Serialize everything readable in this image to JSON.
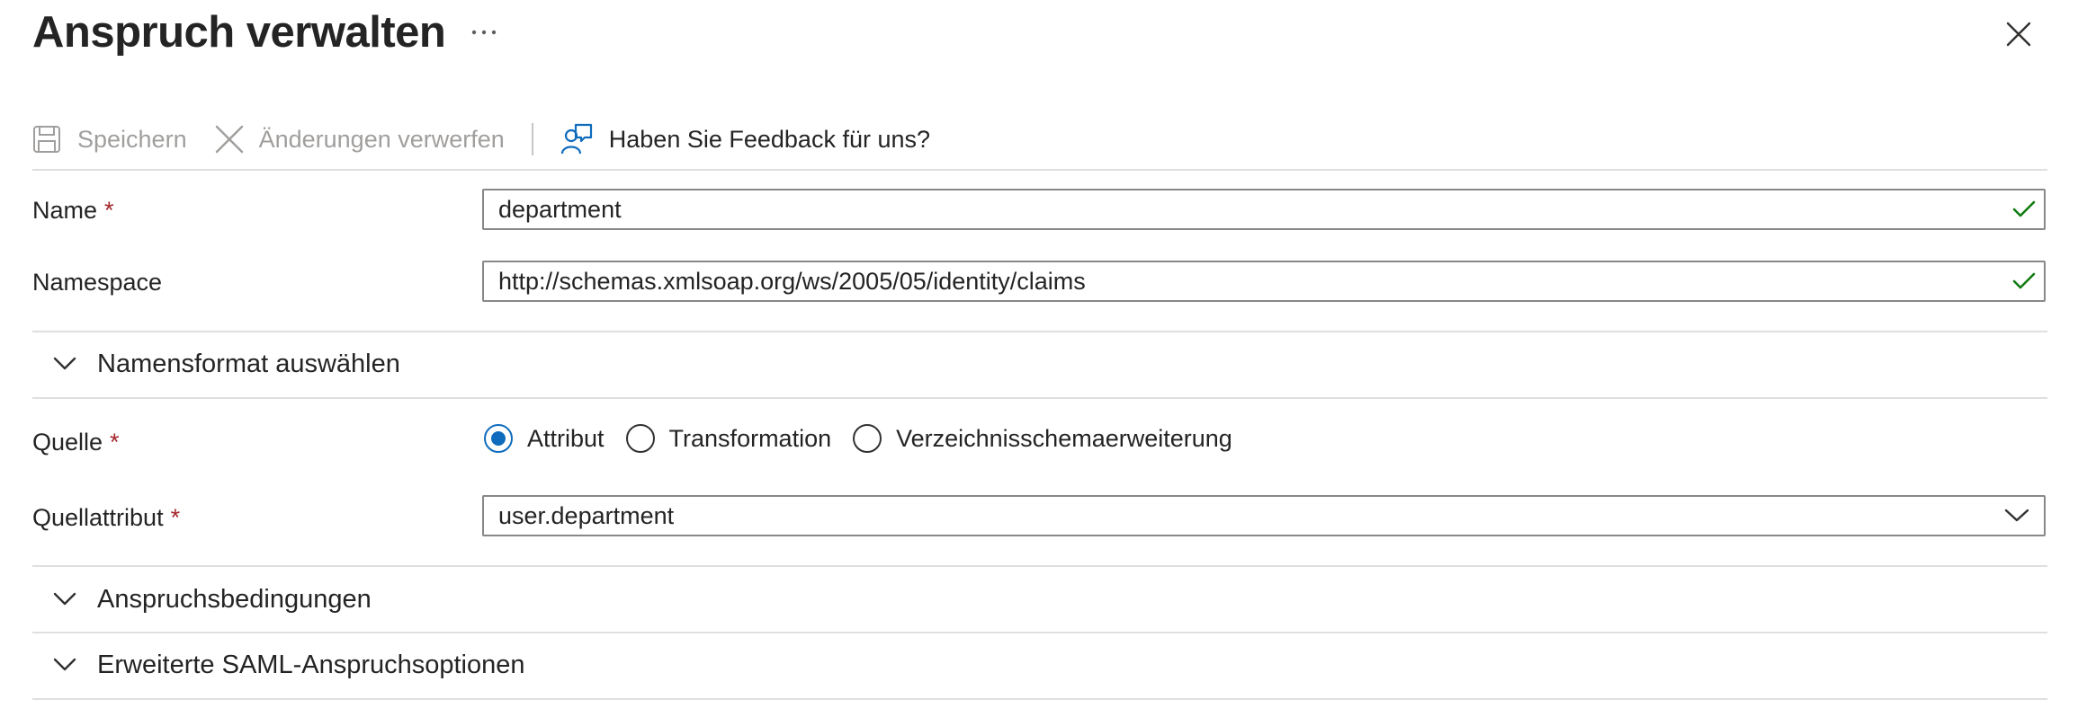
{
  "panel": {
    "title": "Anspruch verwalten",
    "more_label": "···"
  },
  "toolbar": {
    "save_label": "Speichern",
    "discard_label": "Änderungen verwerfen",
    "feedback_label": "Haben Sie Feedback für uns?"
  },
  "form": {
    "name": {
      "label": "Name",
      "required_mark": "*",
      "value": "department"
    },
    "namespace": {
      "label": "Namespace",
      "value": "http://schemas.xmlsoap.org/ws/2005/05/identity/claims"
    },
    "name_format_section": "Namensformat auswählen",
    "source": {
      "label": "Quelle",
      "required_mark": "*",
      "options": [
        "Attribut",
        "Transformation",
        "Verzeichnisschemaerweiterung"
      ],
      "selected": "Attribut"
    },
    "source_attribute": {
      "label": "Quellattribut",
      "required_mark": "*",
      "value": "user.department"
    },
    "claim_conditions_section": "Anspruchsbedingungen",
    "advanced_saml_section": "Erweiterte SAML-Anspruchsoptionen"
  },
  "colors": {
    "accent": "#0f6cbd",
    "required": "#a4262c",
    "valid": "#107c10",
    "disabled": "#a19f9d"
  }
}
